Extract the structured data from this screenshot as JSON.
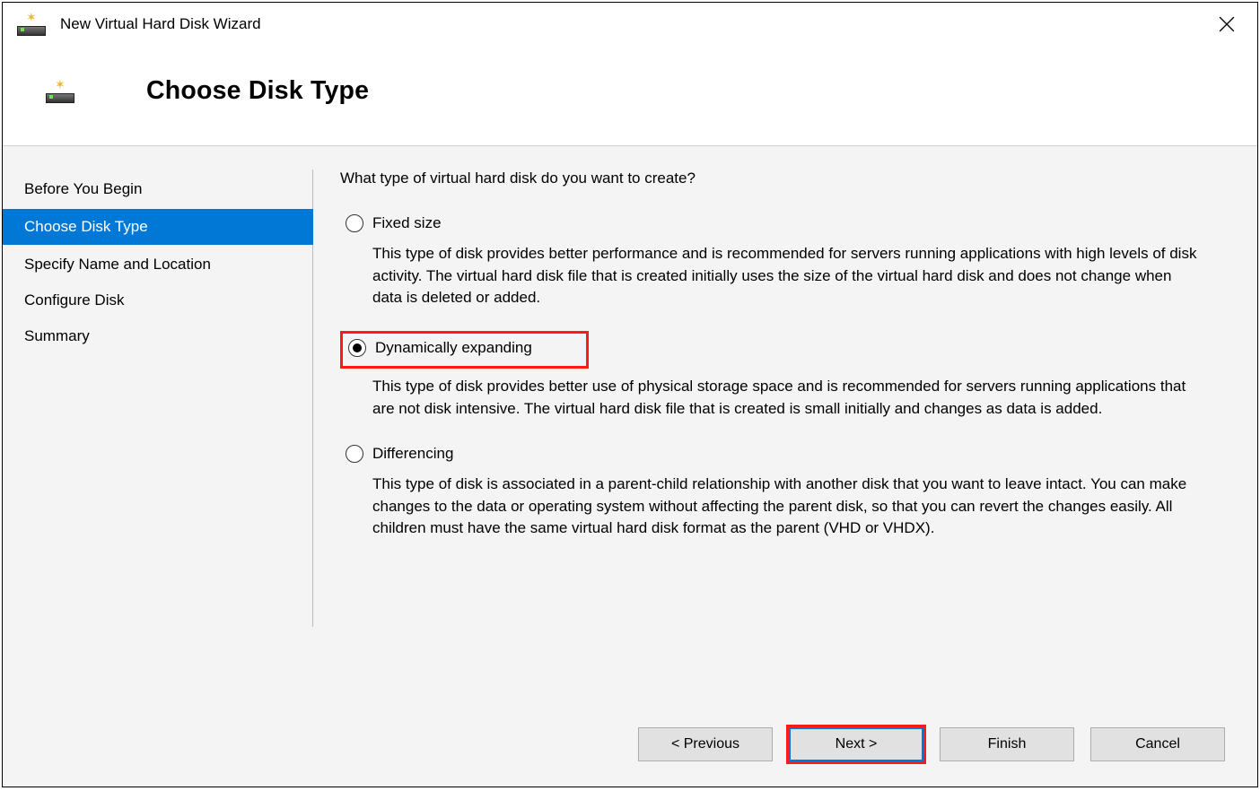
{
  "window": {
    "title": "New Virtual Hard Disk Wizard"
  },
  "header": {
    "heading": "Choose Disk Type"
  },
  "sidebar": {
    "steps": [
      {
        "label": "Before You Begin"
      },
      {
        "label": "Choose Disk Type"
      },
      {
        "label": "Specify Name and Location"
      },
      {
        "label": "Configure Disk"
      },
      {
        "label": "Summary"
      }
    ],
    "active_index": 1
  },
  "main": {
    "prompt": "What type of virtual hard disk do you want to create?",
    "options": [
      {
        "label": "Fixed size",
        "description": "This type of disk provides better performance and is recommended for servers running applications with high levels of disk activity. The virtual hard disk file that is created initially uses the size of the virtual hard disk and does not change when data is deleted or added.",
        "checked": false
      },
      {
        "label": "Dynamically expanding",
        "description": "This type of disk provides better use of physical storage space and is recommended for servers running applications that are not disk intensive. The virtual hard disk file that is created is small initially and changes as data is added.",
        "checked": true,
        "highlighted": true
      },
      {
        "label": "Differencing",
        "description": "This type of disk is associated in a parent-child relationship with another disk that you want to leave intact. You can make changes to the data or operating system without affecting the parent disk, so that you can revert the changes easily. All children must have the same virtual hard disk format as the parent (VHD or VHDX).",
        "checked": false
      }
    ]
  },
  "footer": {
    "previous": "< Previous",
    "next": "Next >",
    "finish": "Finish",
    "cancel": "Cancel"
  }
}
